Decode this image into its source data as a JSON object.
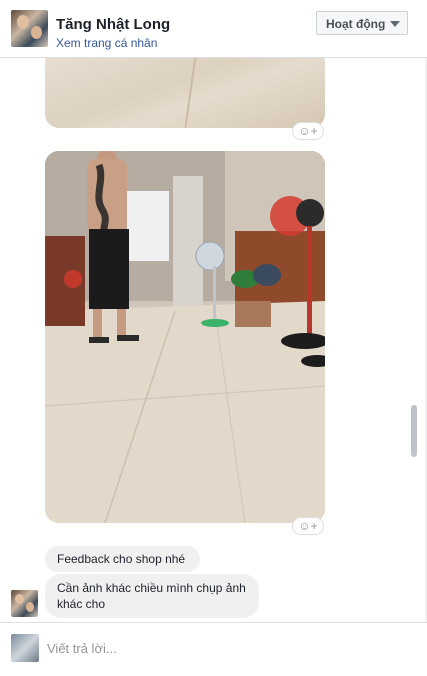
{
  "header": {
    "name": "Tăng Nhật Long",
    "profile_link": "Xem trang cá nhân",
    "status_button": "Hoạt động"
  },
  "messages": [
    {
      "type": "photo",
      "reaction_icon": "add-reaction-icon"
    },
    {
      "type": "photo",
      "reaction_icon": "add-reaction-icon"
    },
    {
      "type": "text",
      "text": "Feedback cho shop nhé"
    },
    {
      "type": "text",
      "text": "Cần ảnh khác chiều mình chụp ảnh khác cho"
    }
  ],
  "composer": {
    "placeholder": "Viết trả lời..."
  },
  "colors": {
    "link": "#365899",
    "bubble": "#f1f0f0",
    "name": "#1d2129"
  }
}
